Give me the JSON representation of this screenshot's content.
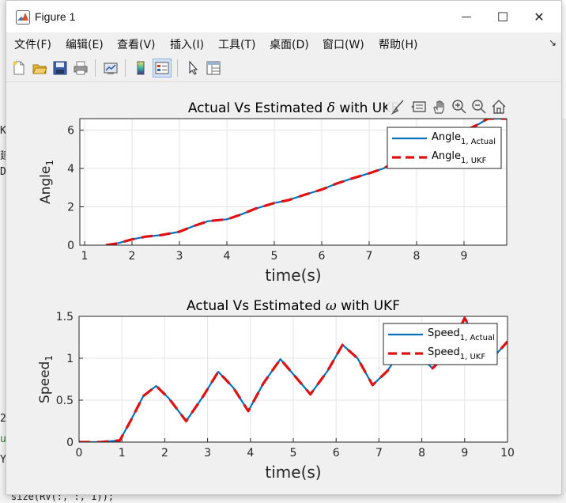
{
  "window": {
    "title": "Figure 1",
    "minimize_glyph": "—",
    "maximize_glyph": "☐",
    "close_glyph": "✕"
  },
  "menu": {
    "items": [
      "文件(F)",
      "编辑(E)",
      "查看(V)",
      "插入(I)",
      "工具(T)",
      "桌面(D)",
      "窗口(W)",
      "帮助(H)"
    ],
    "overflow_glyph": "↘"
  },
  "toolbar": {
    "buttons": [
      "new-figure-icon",
      "open-file-icon",
      "save-icon",
      "print-icon",
      "link-plot-icon",
      "colorbar-icon",
      "legend-icon",
      "pointer-icon",
      "property-inspector-icon"
    ],
    "active": "legend-icon"
  },
  "background": {
    "left_fragments": [
      "K",
      "建",
      "D",
      "2",
      "u",
      "Y"
    ],
    "bottom_fragment": "size(RV(:, :, 1));"
  },
  "axes_toolbar": [
    "brush-icon",
    "data-tip-icon",
    "pan-icon",
    "zoom-in-icon",
    "zoom-out-icon",
    "home-icon"
  ],
  "chart_data": [
    {
      "type": "line",
      "title_prefix": "Actual Vs Estimated ",
      "title_symbol": "δ",
      "title_suffix": " with UKF",
      "xlabel": "time(s)",
      "ylabel_base": "Angle",
      "ylabel_sub": "1",
      "xlim": [
        0.9,
        9.9
      ],
      "ylim": [
        0,
        6.6
      ],
      "xticks": [
        1,
        2,
        3,
        4,
        5,
        6,
        7,
        8,
        9
      ],
      "yticks": [
        0,
        2,
        4,
        6
      ],
      "grid": true,
      "legend_position": "top-right",
      "series": [
        {
          "name_base": "Angle",
          "name_sub": "1, Actual",
          "color": "#0072BD",
          "style": "solid",
          "x": [
            1.45,
            1.7,
            2.0,
            2.3,
            2.6,
            3.0,
            3.3,
            3.6,
            4.0,
            4.3,
            4.6,
            5.0,
            5.3,
            5.6,
            6.0,
            6.3,
            6.6,
            7.0,
            7.3,
            7.6,
            8.0,
            8.3,
            8.6,
            9.0,
            9.3,
            9.5,
            9.9
          ],
          "y": [
            0.0,
            0.1,
            0.3,
            0.45,
            0.52,
            0.7,
            1.0,
            1.25,
            1.35,
            1.6,
            1.9,
            2.2,
            2.35,
            2.6,
            2.9,
            3.2,
            3.45,
            3.75,
            4.0,
            4.4,
            4.85,
            5.1,
            5.45,
            5.95,
            6.3,
            6.6,
            6.6
          ]
        },
        {
          "name_base": "Angle",
          "name_sub": "1, UKF",
          "color": "#E01010",
          "style": "dashed",
          "x": [
            1.45,
            1.7,
            2.0,
            2.3,
            2.6,
            3.0,
            3.3,
            3.6,
            4.0,
            4.3,
            4.6,
            5.0,
            5.3,
            5.6,
            6.0,
            6.3,
            6.6,
            7.0,
            7.3,
            7.6,
            8.0,
            8.3,
            8.6,
            9.0,
            9.3,
            9.5,
            9.9
          ],
          "y": [
            0.0,
            0.1,
            0.3,
            0.45,
            0.52,
            0.7,
            1.0,
            1.25,
            1.35,
            1.6,
            1.9,
            2.2,
            2.35,
            2.6,
            2.9,
            3.2,
            3.45,
            3.75,
            4.0,
            4.4,
            4.85,
            5.1,
            5.45,
            5.95,
            6.3,
            6.6,
            6.6
          ]
        }
      ]
    },
    {
      "type": "line",
      "title_prefix": "Actual Vs Estimated ",
      "title_symbol": "ω",
      "title_suffix": " with UKF",
      "xlabel": "time(s)",
      "ylabel_base": "Speed",
      "ylabel_sub": "1",
      "xlim": [
        0,
        10
      ],
      "ylim": [
        0,
        1.5
      ],
      "xticks": [
        0,
        1,
        2,
        3,
        4,
        5,
        6,
        7,
        8,
        9,
        10
      ],
      "yticks": [
        0,
        0.5,
        1,
        1.5
      ],
      "grid": true,
      "legend_position": "top-right",
      "series": [
        {
          "name_base": "Speed",
          "name_sub": "1, Actual",
          "color": "#0072BD",
          "style": "solid",
          "x": [
            0,
            0.5,
            0.95,
            1.2,
            1.5,
            1.8,
            2.1,
            2.5,
            2.9,
            3.25,
            3.6,
            3.95,
            4.3,
            4.7,
            5.05,
            5.4,
            5.8,
            6.15,
            6.5,
            6.85,
            7.2,
            7.55,
            7.9,
            8.25,
            8.6,
            9.0,
            9.3,
            9.6,
            10.0
          ],
          "y": [
            0,
            0,
            0.02,
            0.25,
            0.55,
            0.67,
            0.52,
            0.25,
            0.55,
            0.84,
            0.65,
            0.37,
            0.7,
            0.99,
            0.78,
            0.57,
            0.85,
            1.16,
            1.0,
            0.68,
            0.85,
            1.12,
            1.05,
            0.88,
            1.05,
            1.48,
            1.2,
            0.97,
            1.2
          ]
        },
        {
          "name_base": "Speed",
          "name_sub": "1, UKF",
          "color": "#E01010",
          "style": "dashed",
          "x": [
            0,
            0.5,
            0.95,
            1.2,
            1.5,
            1.8,
            2.1,
            2.5,
            2.9,
            3.25,
            3.6,
            3.95,
            4.3,
            4.7,
            5.05,
            5.4,
            5.8,
            6.15,
            6.5,
            6.85,
            7.2,
            7.55,
            7.9,
            8.25,
            8.6,
            9.0,
            9.3,
            9.6,
            10.0
          ],
          "y": [
            0,
            0,
            0.02,
            0.25,
            0.55,
            0.67,
            0.52,
            0.25,
            0.55,
            0.84,
            0.65,
            0.37,
            0.7,
            0.99,
            0.78,
            0.57,
            0.85,
            1.16,
            1.0,
            0.68,
            0.85,
            1.12,
            1.05,
            0.88,
            1.05,
            1.48,
            1.2,
            0.97,
            1.2
          ]
        }
      ]
    }
  ]
}
